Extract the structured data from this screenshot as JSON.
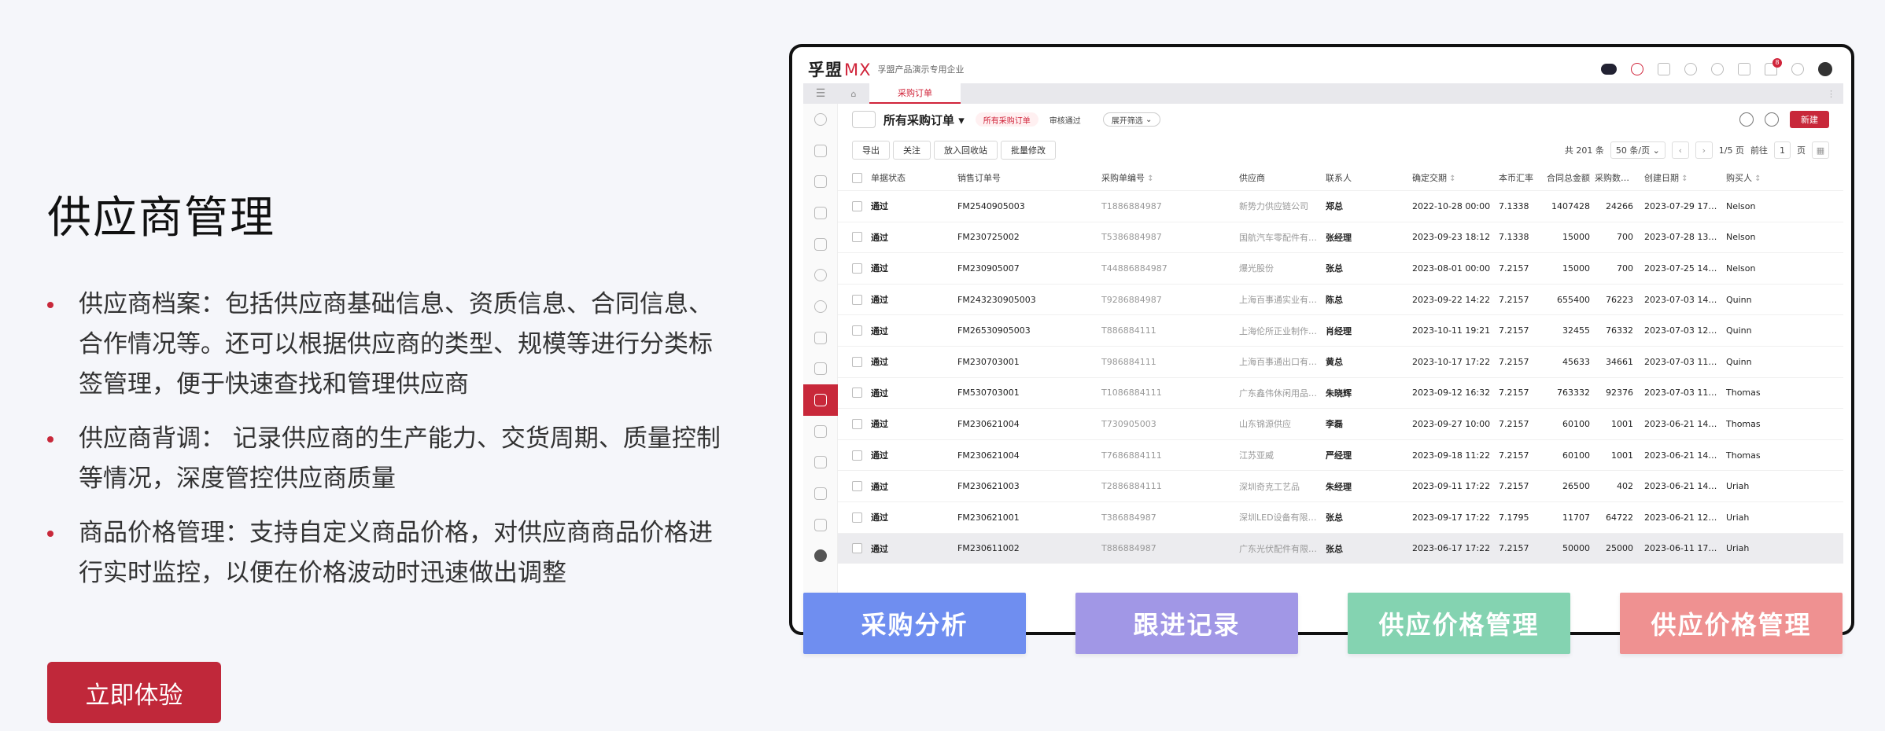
{
  "left": {
    "title": "供应商管理",
    "bullets": [
      "供应商档案：包括供应商基础信息、资质信息、合同信息、合作情况等。还可以根据供应商的类型、规模等进行分类标签管理，便于快速查找和管理供应商",
      "供应商背调： 记录供应商的生产能力、交货周期、质量控制等情况，深度管控供应商质量",
      "商品价格管理：支持自定义商品价格，对供应商商品价格进行实时监控，以便在价格波动时迅速做出调整"
    ],
    "cta_label": "立即体验"
  },
  "app": {
    "logo_text": "孚盟",
    "logo_mx": "MX",
    "company": "孚盟产品演示专用企业",
    "top_icons": [
      "ai-icon",
      "headset-icon",
      "apps-icon",
      "upload-icon",
      "chat-icon",
      "task-icon",
      "bell-icon",
      "help-icon"
    ],
    "notification_count": "8",
    "active_tab": "采购订单",
    "view_name": "所有采购订单",
    "chips": {
      "active": "所有采购订单",
      "plain": "审核通过",
      "outline": "展开筛选"
    },
    "new_label": "新建",
    "actions": [
      "导出",
      "关注",
      "放入回收站",
      "批量修改"
    ],
    "pager": {
      "total": "共 201 条",
      "page_size": "50 条/页",
      "page_info": "1/5 页",
      "goto_label": "前往",
      "goto_value": "1",
      "page_unit": "页"
    },
    "columns": [
      "单据状态",
      "销售订单号",
      "采购单编号",
      "供应商",
      "联系人",
      "确定交期",
      "本币汇率",
      "合同总金额",
      "采购数量合计",
      "创建日期",
      "购买人"
    ],
    "rows": [
      {
        "status": "通过",
        "so": "FM2540905003",
        "po": "T1886884987",
        "supplier": "新势力供应链公司",
        "contact": "郑总",
        "date": "2022-10-28 00:00",
        "rate": "7.1338",
        "amount": "1407428",
        "qty": "24266",
        "created": "2023-07-29 17:…",
        "buyer": "Nelson"
      },
      {
        "status": "通过",
        "so": "FM230725002",
        "po": "T5386884987",
        "supplier": "国航汽车零配件有…",
        "contact": "张经理",
        "date": "2023-09-23 18:12",
        "rate": "7.1338",
        "amount": "15000",
        "qty": "700",
        "created": "2023-07-28 13:…",
        "buyer": "Nelson"
      },
      {
        "status": "通过",
        "so": "FM230905007",
        "po": "T44886884987",
        "supplier": "爆光股份",
        "contact": "张总",
        "date": "2023-08-01 00:00",
        "rate": "7.2157",
        "amount": "15000",
        "qty": "700",
        "created": "2023-07-25 14:…",
        "buyer": "Nelson"
      },
      {
        "status": "通过",
        "so": "FM243230905003",
        "po": "T9286884987",
        "supplier": "上海百事通实业有…",
        "contact": "陈总",
        "date": "2023-09-22 14:22",
        "rate": "7.2157",
        "amount": "655400",
        "qty": "76223",
        "created": "2023-07-03 14:…",
        "buyer": "Quinn"
      },
      {
        "status": "通过",
        "so": "FM26530905003",
        "po": "T886884111",
        "supplier": "上海伦所正业制作…",
        "contact": "肖经理",
        "date": "2023-10-11 19:21",
        "rate": "7.2157",
        "amount": "32455",
        "qty": "76332",
        "created": "2023-07-03 12:…",
        "buyer": "Quinn"
      },
      {
        "status": "通过",
        "so": "FM230703001",
        "po": "T986884111",
        "supplier": "上海百事通出口有…",
        "contact": "黄总",
        "date": "2023-10-17 17:22",
        "rate": "7.2157",
        "amount": "45633",
        "qty": "34661",
        "created": "2023-07-03 11:…",
        "buyer": "Quinn"
      },
      {
        "status": "通过",
        "so": "FM530703001",
        "po": "T1086884111",
        "supplier": "广东鑫伟休闲用品…",
        "contact": "朱晓辉",
        "date": "2023-09-12 16:32",
        "rate": "7.2157",
        "amount": "763332",
        "qty": "92376",
        "created": "2023-07-03 11:…",
        "buyer": "Thomas"
      },
      {
        "status": "通过",
        "so": "FM230621004",
        "po": "T730905003",
        "supplier": "山东锦源供应",
        "contact": "李磊",
        "date": "2023-09-27 10:00",
        "rate": "7.2157",
        "amount": "60100",
        "qty": "1001",
        "created": "2023-06-21 14:…",
        "buyer": "Thomas"
      },
      {
        "status": "通过",
        "so": "FM230621004",
        "po": "T7686884111",
        "supplier": "江苏亚威",
        "contact": "严经理",
        "date": "2023-09-18 11:22",
        "rate": "7.2157",
        "amount": "60100",
        "qty": "1001",
        "created": "2023-06-21 14:…",
        "buyer": "Thomas"
      },
      {
        "status": "通过",
        "so": "FM230621003",
        "po": "T2886884111",
        "supplier": "深圳奇克工艺品",
        "contact": "朱经理",
        "date": "2023-09-11 17:22",
        "rate": "7.2157",
        "amount": "26500",
        "qty": "402",
        "created": "2023-06-21 14:…",
        "buyer": "Uriah"
      },
      {
        "status": "通过",
        "so": "FM230621001",
        "po": "T386884987",
        "supplier": "深圳LED设备有限…",
        "contact": "张总",
        "date": "2023-09-17 17:22",
        "rate": "7.1795",
        "amount": "11707",
        "qty": "64722",
        "created": "2023-06-21 12:…",
        "buyer": "Uriah"
      },
      {
        "status": "通过",
        "so": "FM230611002",
        "po": "T886884987",
        "supplier": "广东光伏配件有限…",
        "contact": "张总",
        "date": "2023-06-17 17:22",
        "rate": "7.2157",
        "amount": "50000",
        "qty": "25000",
        "created": "2023-06-11 17:…",
        "buyer": "Uriah"
      }
    ]
  },
  "features": [
    {
      "label": "采购分析",
      "color": "#6f8ef0"
    },
    {
      "label": "跟进记录",
      "color": "#a197e6"
    },
    {
      "label": "供应价格管理",
      "color": "#84d3b1"
    },
    {
      "label": "供应价格管理",
      "color": "#ef9191"
    }
  ]
}
